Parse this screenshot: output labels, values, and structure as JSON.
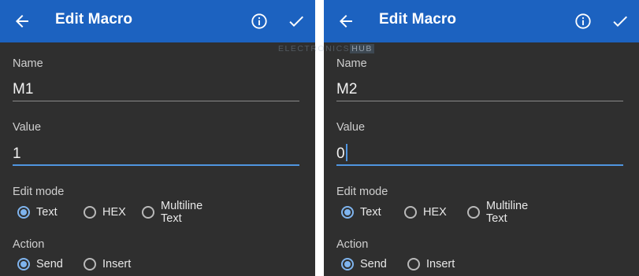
{
  "screens": [
    {
      "app_bar": {
        "title": "Edit Macro",
        "back_icon": "arrow-back-icon",
        "info_icon": "info-icon",
        "confirm_icon": "check-icon"
      },
      "name_label": "Name",
      "name_value": "M1",
      "value_label": "Value",
      "value_value": "1",
      "edit_mode_label": "Edit mode",
      "edit_mode_options": [
        "Text",
        "HEX",
        "Multiline Text"
      ],
      "edit_mode_selected": "Text",
      "action_label": "Action",
      "action_options": [
        "Send",
        "Insert"
      ],
      "action_selected": "Send"
    },
    {
      "app_bar": {
        "title": "Edit Macro",
        "back_icon": "arrow-back-icon",
        "info_icon": "info-icon",
        "confirm_icon": "check-icon"
      },
      "name_label": "Name",
      "name_value": "M2",
      "value_label": "Value",
      "value_value": "0",
      "edit_mode_label": "Edit mode",
      "edit_mode_options": [
        "Text",
        "HEX",
        "Multiline Text"
      ],
      "edit_mode_selected": "Text",
      "action_label": "Action",
      "action_options": [
        "Send",
        "Insert"
      ],
      "action_selected": "Send"
    }
  ],
  "watermark": {
    "prefix": "ELECTRONICS",
    "suffix": "HUB"
  },
  "colors": {
    "app_bar": "#1c62c0",
    "background": "#2f2f2f",
    "accent": "#7fb4ee",
    "focus_underline": "#4f95e0"
  }
}
